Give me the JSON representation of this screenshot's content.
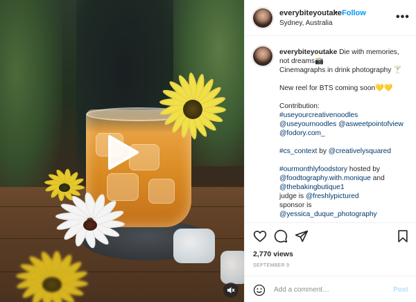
{
  "post": {
    "username": "everybiteyoutake",
    "separator": "•",
    "follow_label": "Follow",
    "location": "Sydney, Australia",
    "more_label": "•••"
  },
  "caption": {
    "username": "everybiteyoutake",
    "first_text": "Die with memories,",
    "line2": "not dreams📸",
    "line3": "Cinemagraphs in drink photography 🍸",
    "line4": "New reel for BTS coming soon💛💛",
    "contribution_label": "Contribution:",
    "tag1": "#useyourcreativenoodles",
    "mention1": "@useyournoodles",
    "mention2": "@asweetpointofview",
    "mention3": "@fodory.com_",
    "tag2": "#cs_context",
    "by_text": " by ",
    "mention4": "@creativelysquared",
    "tag3": "#ourmonthlyfoodstory",
    "hosted_text": " hosted by",
    "mention5": "@foodtography.with.monique",
    "and_text": " and",
    "mention6": "@thebakingbutique1",
    "judge_text": "judge is ",
    "mention7": "@freshlypictured",
    "sponsor_text": "sponsor is",
    "mention8": "@yessica_duque_photography"
  },
  "stats": {
    "views": "2,770 views",
    "date": "SEPTEMBER 9"
  },
  "comment_box": {
    "placeholder": "Add a comment…",
    "post_label": "Post"
  },
  "icons": {
    "like": "heart-icon",
    "comment": "comment-icon",
    "share": "send-icon",
    "save": "bookmark-icon",
    "emoji": "smiley-icon",
    "play": "play-icon",
    "audio": "speaker-muted-icon"
  },
  "colors": {
    "follow": "#0095f6",
    "link": "#00376b",
    "post_disabled": "#b2dffc",
    "muted": "#8e8e8e"
  }
}
